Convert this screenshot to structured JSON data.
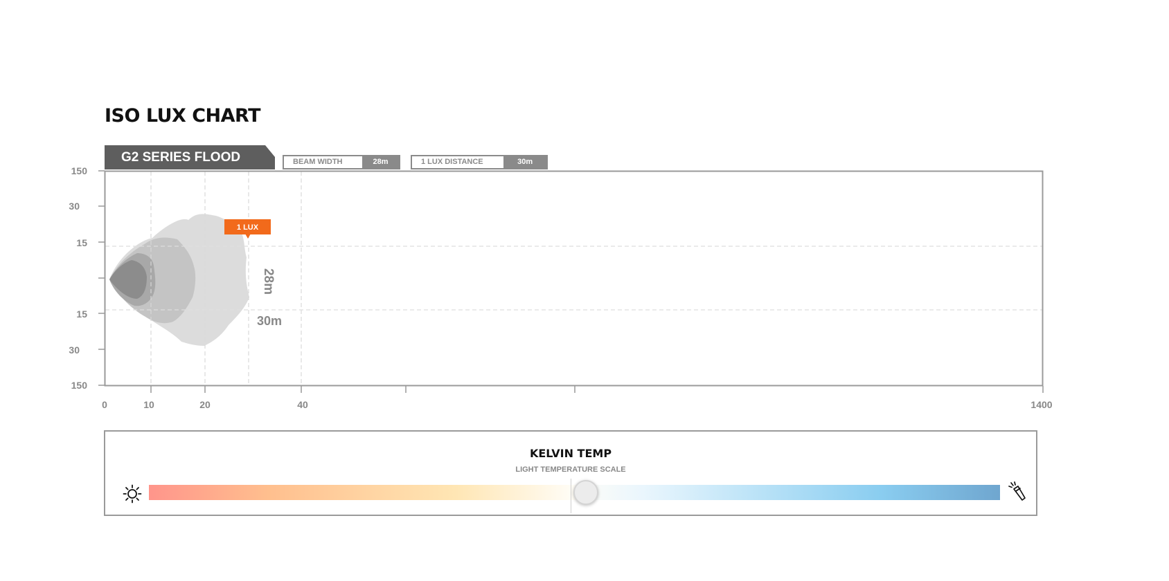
{
  "page_title": "ISO LUX CHART",
  "series_label": "G2 SERIES FLOOD",
  "stats": {
    "beam_width_label": "BEAM WIDTH",
    "beam_width_value": "28m",
    "lux_distance_label": "1 LUX DISTANCE",
    "lux_distance_value": "30m"
  },
  "chart_data": {
    "type": "area",
    "title": "ISO LUX CHART",
    "subtitle": "G2 SERIES FLOOD",
    "x_ticks": [
      "0",
      "10",
      "20",
      "40",
      "1400"
    ],
    "y_ticks_top": [
      "150",
      "30",
      "15"
    ],
    "y_ticks_bottom": [
      "15",
      "30",
      "150"
    ],
    "callout": "1 LUX",
    "beam_width_label": "28m",
    "lux_distance_label": "30m",
    "colors": {
      "contour_outer": "#dcdcdc",
      "contour_2": "#c4c4c4",
      "contour_3": "#a8a8a8",
      "contour_inner": "#8c8c8c",
      "callout": "#f26a1b",
      "axis": "#999999"
    }
  },
  "kelvin": {
    "title": "KELVIN TEMP",
    "subtitle": "LIGHT TEMPERATURE SCALE",
    "position": 0.5,
    "left_icon": "sun-icon",
    "right_icon": "flashlight-icon",
    "gradient_colors": [
      "#ff958b",
      "#ffe6b4",
      "#fffdf7",
      "#8acdf0",
      "#6fa6cf"
    ]
  }
}
